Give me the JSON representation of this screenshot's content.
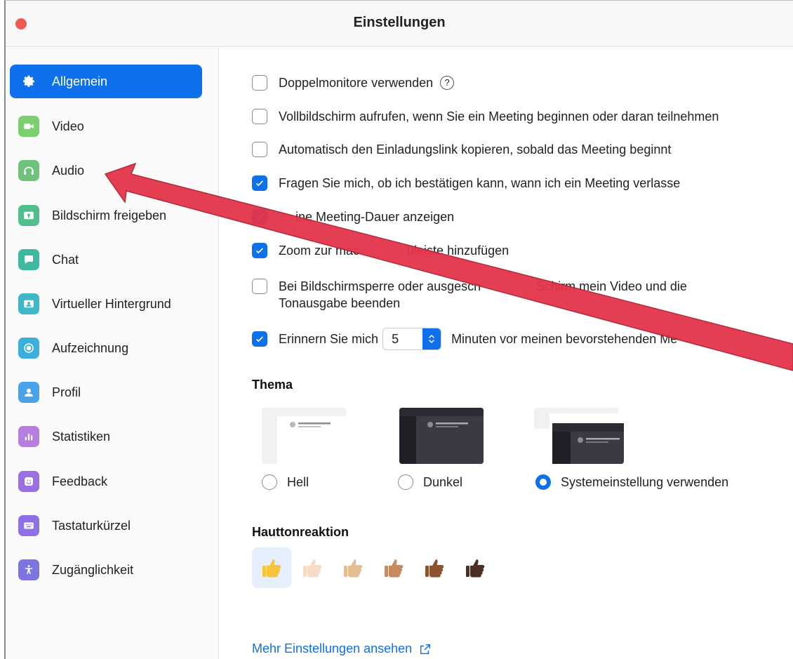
{
  "window": {
    "title": "Einstellungen"
  },
  "sidebar": {
    "items": [
      {
        "label": "Allgemein",
        "icon": "gear-icon",
        "color": "#ffffff"
      },
      {
        "label": "Video",
        "icon": "video-camera-icon",
        "color": "#7bcf6f"
      },
      {
        "label": "Audio",
        "icon": "headphones-icon",
        "color": "#6fc27a"
      },
      {
        "label": "Bildschirm freigeben",
        "icon": "share-screen-icon",
        "color": "#4fbf8d"
      },
      {
        "label": "Chat",
        "icon": "chat-icon",
        "color": "#3fb8a0"
      },
      {
        "label": "Virtueller Hintergrund",
        "icon": "virtual-background-icon",
        "color": "#3fb7c6"
      },
      {
        "label": "Aufzeichnung",
        "icon": "record-icon",
        "color": "#3aaedc"
      },
      {
        "label": "Profil",
        "icon": "profile-icon",
        "color": "#4aa3e8"
      },
      {
        "label": "Statistiken",
        "icon": "statistics-icon",
        "color": "#b67ee0"
      },
      {
        "label": "Feedback",
        "icon": "feedback-icon",
        "color": "#9b6fe0"
      },
      {
        "label": "Tastaturkürzel",
        "icon": "keyboard-icon",
        "color": "#8d6fe6"
      },
      {
        "label": "Zugänglichkeit",
        "icon": "accessibility-icon",
        "color": "#7d74e0"
      }
    ],
    "active_index": 0
  },
  "general": {
    "options": [
      {
        "label": "Doppelmonitore verwenden",
        "checked": false
      },
      {
        "label": "Vollbildschirm aufrufen, wenn Sie ein Meeting beginnen oder daran teilnehmen",
        "checked": false
      },
      {
        "label": "Automatisch den Einladungslink kopieren, sobald das Meeting beginnt",
        "checked": false
      },
      {
        "label": "Fragen Sie mich, ob ich bestätigen kann, wann ich ein Meeting verlasse",
        "checked": true
      },
      {
        "label": "ine Meeting-Dauer anzeigen",
        "checked": true
      },
      {
        "label_a": "Zoom zur mac",
        "label_b": "üleiste hinzufügen",
        "checked": true
      },
      {
        "label_a": "Bei Bildschirmsperre oder ausgesch",
        "label_b": "Schirm mein Video und die",
        "label_line2": "Tonausgabe beenden",
        "checked": false
      }
    ],
    "reminder": {
      "label_before": "Erinnern Sie mich",
      "minutes": "5",
      "label_after": "Minuten vor meinen bevorstehenden Me",
      "checked": true
    }
  },
  "theme": {
    "heading": "Thema",
    "options": [
      {
        "label": "Hell",
        "selected": false
      },
      {
        "label": "Dunkel",
        "selected": false
      },
      {
        "label": "Systemeinstellung verwenden",
        "selected": true
      }
    ]
  },
  "skin_tone": {
    "heading": "Hauttonreaktion",
    "tones": [
      "#f7c53c",
      "#f6dcc4",
      "#e4bd93",
      "#c68b5e",
      "#8d5430",
      "#4a2f25"
    ],
    "selected_index": 0
  },
  "footer": {
    "more_link": "Mehr Einstellungen ansehen"
  },
  "colors": {
    "accent": "#0e71eb",
    "annotation_arrow": "#e2344a"
  }
}
